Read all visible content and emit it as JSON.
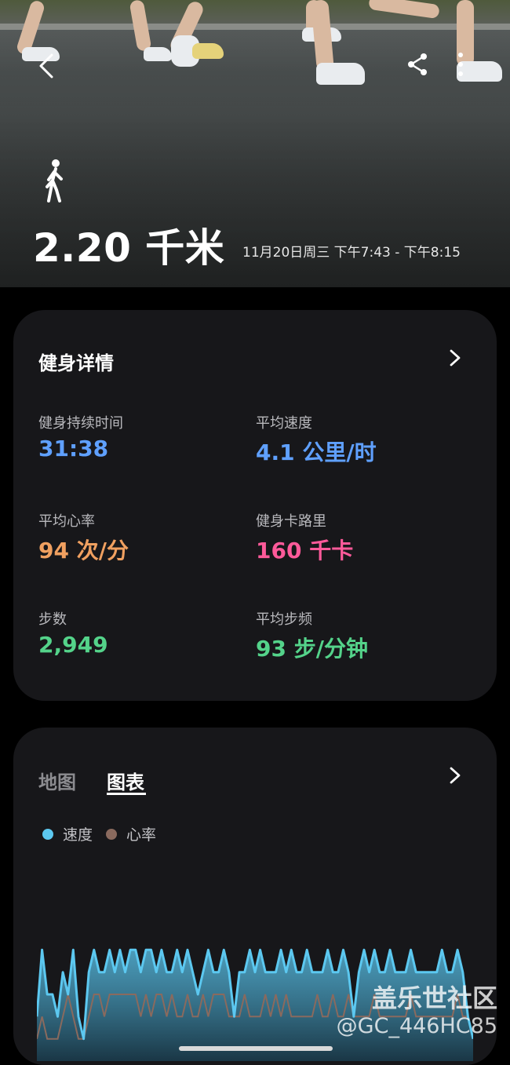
{
  "colors": {
    "blue": "#5fa0ff",
    "orange": "#f0a060",
    "pink": "#ff5a9a",
    "green": "#54d38a",
    "speed_series": "#5cc8f0",
    "heart_series": "#8a6a5e"
  },
  "hero": {
    "distance": "2.20 千米",
    "time_range": "11月20日周三 下午7:43 - 下午8:15",
    "activity_icon": "walking-icon",
    "back_icon": "back-arrow-icon",
    "share_icon": "share-icon",
    "more_icon": "more-vertical-icon"
  },
  "details": {
    "title": "健身详情",
    "metrics": [
      {
        "label": "健身持续时间",
        "value": "31:38"
      },
      {
        "label": "平均速度",
        "value": "4.1 公里/时"
      },
      {
        "label": "平均心率",
        "value": "94 次/分"
      },
      {
        "label": "健身卡路里",
        "value": "160 千卡"
      },
      {
        "label": "步数",
        "value": "2,949"
      },
      {
        "label": "平均步频",
        "value": "93 步/分钟"
      }
    ]
  },
  "chart_card": {
    "tabs": [
      {
        "label": "地图",
        "selected": false
      },
      {
        "label": "图表",
        "selected": true
      }
    ],
    "legend": [
      "速度",
      "心率"
    ]
  },
  "watermark": {
    "line1": "盖乐世社区",
    "line2": "@GC_446HC85"
  },
  "chart_data": {
    "type": "line",
    "title": "",
    "xlabel": "",
    "ylabel": "",
    "series": [
      {
        "name": "速度",
        "values": [
          2,
          5,
          3,
          3,
          2,
          4,
          3,
          5,
          2,
          1,
          4,
          5,
          4,
          4,
          5,
          4,
          5,
          4,
          5,
          5,
          4,
          5,
          5,
          4,
          5,
          4,
          4,
          5,
          4,
          5,
          4,
          3,
          4,
          5,
          4,
          4,
          5,
          4,
          2,
          4,
          4,
          5,
          4,
          5,
          4,
          4,
          4,
          5,
          4,
          5,
          4,
          4,
          5,
          4,
          4,
          4,
          5,
          4,
          4,
          5,
          4,
          2,
          4,
          5,
          4,
          5,
          4,
          4,
          5,
          4,
          4,
          4,
          5,
          4,
          4,
          4,
          4,
          4,
          5,
          4,
          4,
          5,
          4,
          2,
          1
        ]
      },
      {
        "name": "心率",
        "values": [
          1,
          2,
          1,
          1,
          1,
          2,
          3,
          2,
          1,
          1,
          2,
          3,
          3,
          2,
          3,
          3,
          3,
          3,
          3,
          3,
          2,
          3,
          2,
          3,
          3,
          2,
          3,
          2,
          2,
          3,
          2,
          2,
          3,
          2,
          3,
          3,
          3,
          2,
          2,
          2,
          3,
          2,
          2,
          2,
          3,
          2,
          3,
          2,
          3,
          2,
          2,
          2,
          2,
          2,
          3,
          2,
          2,
          3,
          2,
          2,
          3,
          2,
          2,
          2,
          2,
          3,
          2,
          2,
          2,
          2,
          2,
          2,
          3,
          2,
          2,
          2,
          2,
          2,
          2,
          2,
          2,
          3,
          2,
          2,
          1
        ]
      }
    ],
    "legend_position": "top-left",
    "grid": false
  }
}
